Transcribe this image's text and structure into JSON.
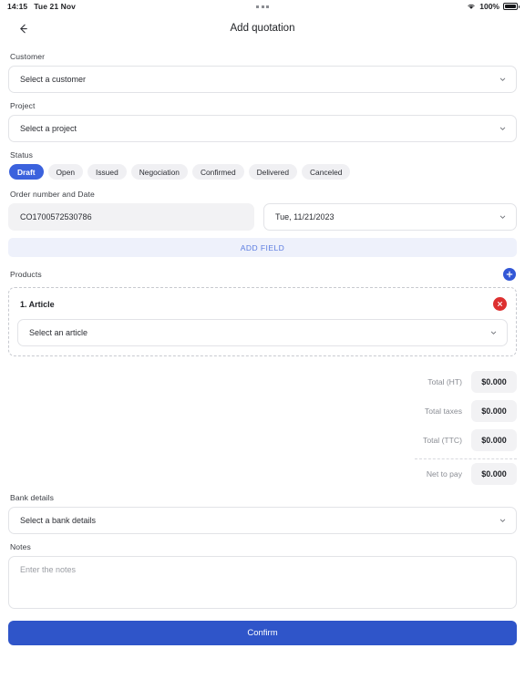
{
  "status_bar": {
    "time": "14:15",
    "date": "Tue 21 Nov",
    "battery_percent": "100%",
    "wifi_icon": "wifi-icon",
    "battery_icon": "battery-full-icon",
    "center_dots_icon": "three-dots-icon"
  },
  "appbar": {
    "back_icon": "back-arrow-icon",
    "title": "Add quotation"
  },
  "customer": {
    "label": "Customer",
    "value": "Select a customer",
    "chevron_icon": "chevron-down-icon"
  },
  "project": {
    "label": "Project",
    "value": "Select a project",
    "chevron_icon": "chevron-down-icon"
  },
  "status": {
    "label": "Status",
    "selected": "Draft",
    "options": [
      "Draft",
      "Open",
      "Issued",
      "Negociation",
      "Confirmed",
      "Delivered",
      "Canceled"
    ]
  },
  "order": {
    "label": "Order number and Date",
    "number": "CO1700572530786",
    "date": "Tue, 11/21/2023",
    "chevron_icon": "chevron-down-icon",
    "add_field_label": "ADD FIELD"
  },
  "products": {
    "label": "Products",
    "add_icon": "plus-icon",
    "items": [
      {
        "title": "1. Article",
        "article_value": "Select an article",
        "remove_icon": "close-icon",
        "chevron_icon": "chevron-down-icon"
      }
    ]
  },
  "totals": [
    {
      "label": "Total (HT)",
      "value": "$0.000"
    },
    {
      "label": "Total taxes",
      "value": "$0.000"
    },
    {
      "label": "Total (TTC)",
      "value": "$0.000"
    },
    {
      "label": "Net to pay",
      "value": "$0.000"
    }
  ],
  "bank": {
    "label": "Bank details",
    "value": "Select a bank details",
    "chevron_icon": "chevron-down-icon"
  },
  "notes": {
    "label": "Notes",
    "placeholder": "Enter the notes"
  },
  "confirm": {
    "label": "Confirm"
  },
  "colors": {
    "accent_blue": "#2f55c9",
    "chip_blue": "#3b62dd",
    "delete_red": "#dd3030",
    "add_field_bg": "#eef1fb",
    "field_grey": "#f2f2f4"
  }
}
